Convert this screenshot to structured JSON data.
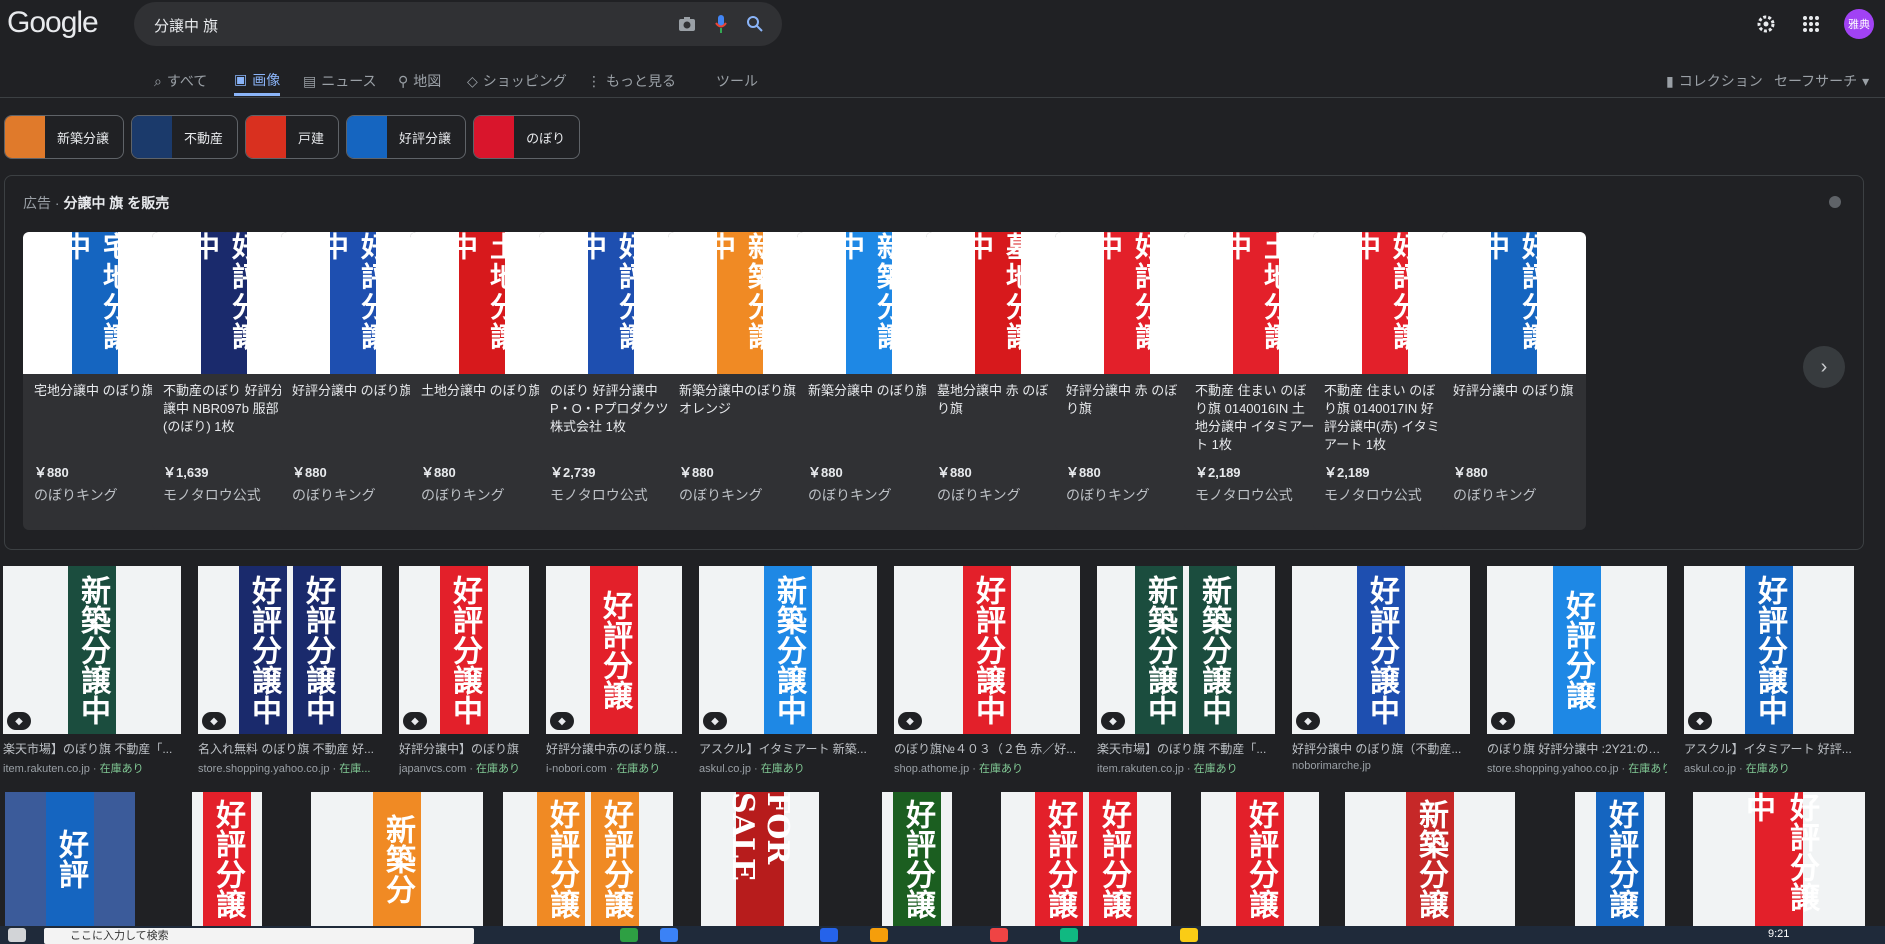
{
  "header": {
    "logo": "Google",
    "query": "分譲中 旗",
    "avatar": "雅典"
  },
  "tabs": [
    {
      "label": "すべて",
      "icon": "search-icon"
    },
    {
      "label": "画像",
      "icon": "image-icon",
      "active": true
    },
    {
      "label": "ニュース",
      "icon": "news-icon"
    },
    {
      "label": "地図",
      "icon": "map-pin-icon"
    },
    {
      "label": "ショッピング",
      "icon": "tag-icon"
    },
    {
      "label": "もっと見る",
      "icon": "more-vert-icon"
    },
    {
      "label": "ツール"
    }
  ],
  "right_tabs": {
    "collection": "コレクション",
    "safesearch": "セーフサーチ"
  },
  "chips": [
    {
      "label": "新築分譲",
      "color": "#e07a2b"
    },
    {
      "label": "不動産",
      "color": "#1b3a6b"
    },
    {
      "label": "戸建",
      "color": "#d9301f"
    },
    {
      "label": "好評分譲",
      "color": "#1565c0"
    },
    {
      "label": "のぼり",
      "color": "#d9152c"
    }
  ],
  "ad": {
    "prefix": "広告 · ",
    "title": "分譲中 旗 を販売",
    "products": [
      {
        "title": "宅地分譲中 のぼり旗",
        "price": "￥880",
        "seller": "のぼりキング",
        "flag": "宅地分譲中",
        "color": "#1565c0"
      },
      {
        "title": "不動産のぼり 好評分譲中 NBR097b 服部(のぼり) 1枚",
        "price": "￥1,639",
        "seller": "モノタロウ公式",
        "flag": "好評分譲中",
        "color": "#1a2a6c"
      },
      {
        "title": "好評分譲中 のぼり旗",
        "price": "￥880",
        "seller": "のぼりキング",
        "flag": "好評分譲中",
        "color": "#1e4fb0"
      },
      {
        "title": "土地分譲中 のぼり旗",
        "price": "￥880",
        "seller": "のぼりキング",
        "flag": "土地分譲中",
        "color": "#d7191c"
      },
      {
        "title": "のぼり 好評分譲中 P・O・Pプロダクツ 株式会社 1枚",
        "price": "￥2,739",
        "seller": "モノタロウ公式",
        "flag": "好評分譲中",
        "color": "#1e4fb0"
      },
      {
        "title": "新築分譲中のぼり旗 オレンジ",
        "price": "￥880",
        "seller": "のぼりキング",
        "flag": "新築分譲中",
        "color": "#f08a24"
      },
      {
        "title": "新築分譲中 のぼり旗",
        "price": "￥880",
        "seller": "のぼりキング",
        "flag": "新築分譲中",
        "color": "#1e88e5"
      },
      {
        "title": "墓地分譲中 赤 のぼり旗",
        "price": "￥880",
        "seller": "のぼりキング",
        "flag": "墓地分譲中",
        "color": "#d7191c"
      },
      {
        "title": "好評分譲中 赤 のぼり旗",
        "price": "￥880",
        "seller": "のぼりキング",
        "flag": "好評分譲中",
        "color": "#e3202a"
      },
      {
        "title": "不動産 住まい のぼり旗 0140016IN 土地分譲中 イタミアート 1枚",
        "price": "￥2,189",
        "seller": "モノタロウ公式",
        "flag": "土地分譲中",
        "color": "#e3202a"
      },
      {
        "title": "不動産 住まい のぼり旗 0140017IN 好評分譲中(赤) イタミアート 1枚",
        "price": "￥2,189",
        "seller": "モノタロウ公式",
        "flag": "好評分譲中",
        "color": "#e3202a"
      },
      {
        "title": "好評分譲中 のぼり旗",
        "price": "￥880",
        "seller": "のぼりキング",
        "flag": "好評分譲中",
        "color": "#1565c0"
      }
    ]
  },
  "results": [
    {
      "title": "楽天市場】のぼり旗 不動産「...",
      "source": "item.rakuten.co.jp",
      "stock": "在庫あり",
      "flag": "新築分譲中",
      "color": "#1b4d3e"
    },
    {
      "title": "名入れ無料 のぼり旗 不動産 好...",
      "source": "store.shopping.yahoo.co.jp",
      "stock": "在庫...",
      "flag": "好評分譲中",
      "color": "#1a2a6c"
    },
    {
      "title": "好評分譲中】のぼり旗",
      "source": "japanvcs.com",
      "stock": "在庫あり",
      "flag": "好評分譲中",
      "color": "#e3202a"
    },
    {
      "title": "好評分譲中赤のぼり旗0...",
      "source": "i-nobori.com",
      "stock": "在庫あり",
      "flag": "好評分譲",
      "color": "#e3202a"
    },
    {
      "title": "アスクル】イタミアート 新築...",
      "source": "askul.co.jp",
      "stock": "在庫あり",
      "flag": "新築分譲中",
      "color": "#1e88e5"
    },
    {
      "title": "のぼり旗№４０３（２色 赤／好...",
      "source": "shop.athome.jp",
      "stock": "在庫あり",
      "flag": "好評分譲中",
      "color": "#e3202a"
    },
    {
      "title": "楽天市場】のぼり旗 不動産「...",
      "source": "item.rakuten.co.jp",
      "stock": "在庫あり",
      "flag": "新築分譲中",
      "color": "#1b4d3e"
    },
    {
      "title": "好評分譲中 のぼり旗（不動産...",
      "source": "noborimarche.jp",
      "stock": "",
      "flag": "好評分譲中",
      "color": "#1e4fb0"
    },
    {
      "title": "のぼり旗 好評分譲中 :2Y21:のぼ...",
      "source": "store.shopping.yahoo.co.jp",
      "stock": "在庫あり",
      "flag": "好評分譲",
      "color": "#1e88e5"
    },
    {
      "title": "アスクル】イタミアート 好評...",
      "source": "askul.co.jp",
      "stock": "在庫あり",
      "flag": "好評分譲中",
      "color": "#1565c0"
    }
  ],
  "row2": [
    {
      "flag": "好評",
      "color": "#1565c0"
    },
    {
      "flag": "好評分譲",
      "color": "#e3202a"
    },
    {
      "flag": "新築分",
      "color": "#f08a24"
    },
    {
      "flag": "好評分譲",
      "color": "#f08a24"
    },
    {
      "flag": "FOR SALE",
      "color": "#b71c1c"
    },
    {
      "flag": "好評分譲",
      "color": "#1b5e20"
    },
    {
      "flag": "好評分譲",
      "color": "#e3202a"
    },
    {
      "flag": "好評分譲",
      "color": "#e3202a"
    },
    {
      "flag": "新築分譲",
      "color": "#c62828"
    },
    {
      "flag": "好評分譲",
      "color": "#1565c0"
    },
    {
      "flag": "好評分譲中",
      "color": "#e3202a"
    }
  ],
  "taskbar": {
    "search_placeholder": "ここに入力して検索",
    "time": "9:21"
  }
}
